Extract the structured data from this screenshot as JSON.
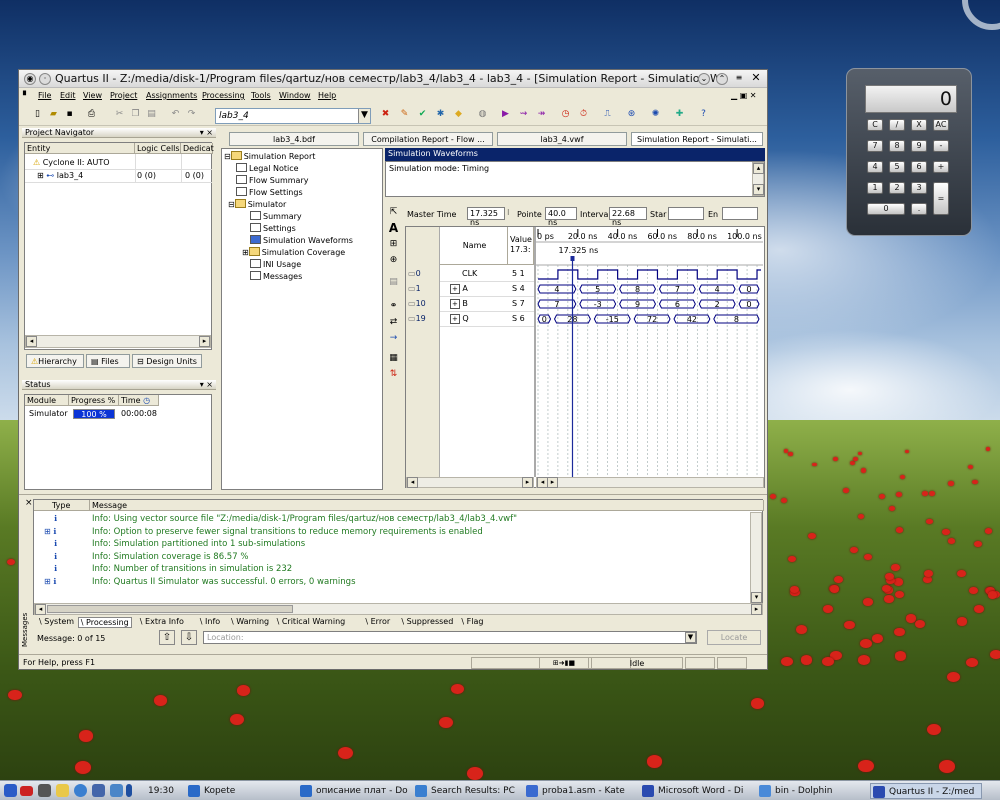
{
  "window": {
    "title": "Quartus II - Z:/media/disk-1/Program files/qartuz/нов семестр/lab3_4/lab3_4 - lab3_4 - [Simulation Report - Simulation Wa"
  },
  "menu": [
    "File",
    "Edit",
    "View",
    "Project",
    "Assignments",
    "Processing",
    "Tools",
    "Window",
    "Help"
  ],
  "toolbar": {
    "entity_combo": "lab3_4"
  },
  "project_navigator": {
    "title": "Project Navigator",
    "columns": [
      "Entity",
      "Logic Cells",
      "Dedicat"
    ],
    "device": "Cyclone II: AUTO",
    "rows": [
      {
        "name": "lab3_4",
        "cells": "0 (0)",
        "dedicated": "0 (0)"
      }
    ],
    "tabs": [
      "Hierarchy",
      "Files",
      "Design Units"
    ]
  },
  "status": {
    "title": "Status",
    "columns": [
      "Module",
      "Progress %",
      "Time"
    ],
    "rows": [
      {
        "module": "Simulator",
        "progress_label": "100 %",
        "progress": 1.0,
        "time": "00:00:08"
      }
    ]
  },
  "doc_tabs": [
    "lab3_4.bdf",
    "Compilation Report - Flow ...",
    "lab3_4.vwf",
    "Simulation Report - Simulati..."
  ],
  "report_tree": [
    "Simulation Report",
    "Legal Notice",
    "Flow Summary",
    "Flow Settings",
    "Simulator",
    "Summary",
    "Settings",
    "Simulation Waveforms",
    "Simulation Coverage",
    "INI Usage",
    "Messages"
  ],
  "sim": {
    "header": "Simulation Waveforms",
    "mode": "Simulation mode: Timing"
  },
  "wave_bar": {
    "master_label": "Master Time",
    "master_val": "17.325 ns",
    "pointer_label": "Pointe",
    "pointer_val": "40.0 ns",
    "interval_label": "Interva",
    "interval_val": "22.68 ns",
    "start_label": "Star",
    "end_label": "En"
  },
  "wave_cols": {
    "name": "Name",
    "value": "Value",
    "value_sub": "17.3:"
  },
  "time_ticks": [
    "0 ps",
    "20.0 ns",
    "40.0 ns",
    "60.0 ns",
    "80.0 ns",
    "100.0 ns"
  ],
  "cursor_label": "17.325 ns",
  "signals": [
    {
      "idx": "0",
      "name": "CLK",
      "value": "5 1",
      "values": []
    },
    {
      "idx": "1",
      "name": "A",
      "value": "S 4",
      "values": [
        "4",
        "5",
        "8",
        "7",
        "4",
        "0"
      ]
    },
    {
      "idx": "10",
      "name": "B",
      "value": "S 7",
      "values": [
        "7",
        "-3",
        "9",
        "6",
        "2",
        "0"
      ]
    },
    {
      "idx": "19",
      "name": "Q",
      "value": "S 6",
      "values": [
        "0",
        "28",
        "-15",
        "72",
        "42",
        "8"
      ]
    }
  ],
  "messages": {
    "columns": [
      "Type",
      "Message"
    ],
    "lines": [
      "Info: Using vector source file \"Z:/media/disk-1/Program files/qartuz/нов семестр/lab3_4/lab3_4.vwf\"",
      "Info: Option to preserve fewer signal transitions to reduce memory requirements is enabled",
      "Info: Simulation partitioned into 1 sub-simulations",
      "Info: Simulation coverage is      86.57 %",
      "Info: Number of transitions in simulation is 232",
      "Info: Quartus II Simulator was successful. 0 errors, 0 warnings"
    ],
    "tabs": [
      "System",
      "Processing",
      "Extra Info",
      "Info",
      "Warning",
      "Critical Warning",
      "Error",
      "Suppressed",
      "Flag"
    ],
    "count": "Message: 0 of 15",
    "location": "Location:",
    "locate": "Locate",
    "side_label": "Messages"
  },
  "statusbar": {
    "help": "For Help, press F1",
    "state": "Idle"
  },
  "calculator": {
    "display": "0",
    "keys": [
      "C",
      "/",
      "X",
      "AC",
      "7",
      "8",
      "9",
      "-",
      "4",
      "5",
      "6",
      "+",
      "1",
      "2",
      "3",
      "0",
      ".",
      "="
    ]
  },
  "taskbar": {
    "clock": "19:30",
    "items": [
      "Kopete",
      "описание плат - Do",
      "Search Results: PC",
      "proba1.asm - Kate",
      "Microsoft Word - Di",
      "bin - Dolphin",
      "Quartus II - Z:/med"
    ]
  },
  "colors": {
    "progress": "#0b34d6",
    "clock_wave": "#000080",
    "cursor": "#1b2a9a",
    "title_blue": "#0a246a"
  }
}
